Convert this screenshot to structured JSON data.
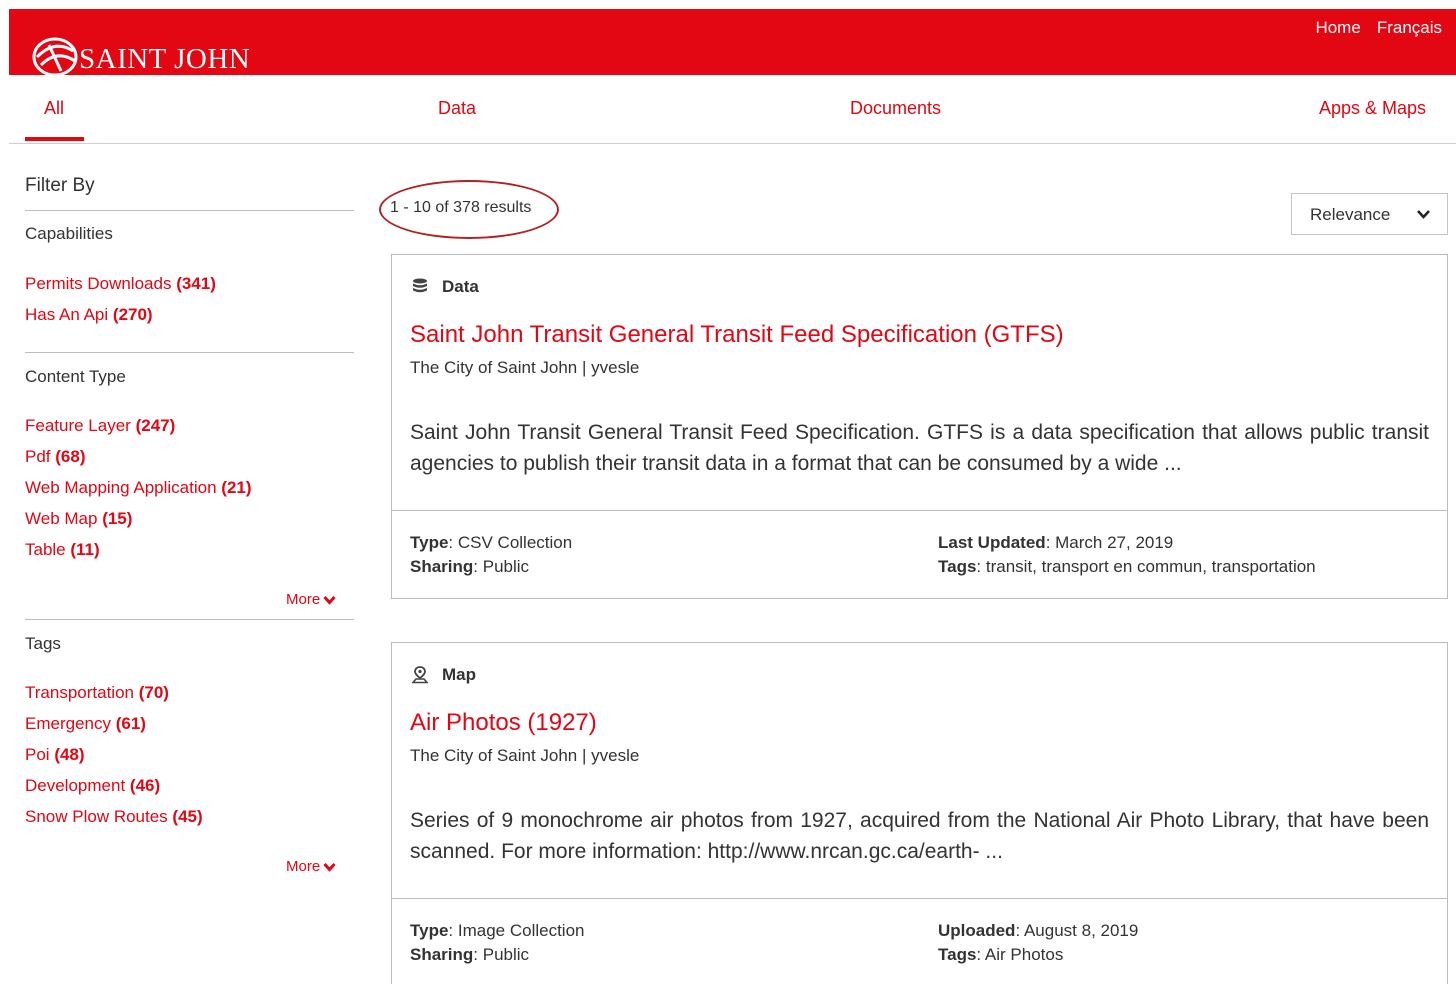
{
  "header": {
    "brand": "SAINT JOHN",
    "links": [
      "Home",
      "Français"
    ]
  },
  "tabs": [
    "All",
    "Data",
    "Documents",
    "Apps & Maps"
  ],
  "sidebar": {
    "title": "Filter By",
    "capabilities": {
      "title": "Capabilities",
      "items": [
        {
          "label": "Permits Downloads",
          "count": "(341)"
        },
        {
          "label": "Has An Api",
          "count": "(270)"
        }
      ]
    },
    "content_type": {
      "title": "Content Type",
      "items": [
        {
          "label": "Feature Layer",
          "count": "(247)"
        },
        {
          "label": "Pdf",
          "count": "(68)"
        },
        {
          "label": "Web Mapping Application",
          "count": "(21)"
        },
        {
          "label": "Web Map",
          "count": "(15)"
        },
        {
          "label": "Table",
          "count": "(11)"
        }
      ],
      "more": "More"
    },
    "tags": {
      "title": "Tags",
      "items": [
        {
          "label": "Transportation",
          "count": "(70)"
        },
        {
          "label": "Emergency",
          "count": "(61)"
        },
        {
          "label": "Poi",
          "count": "(48)"
        },
        {
          "label": "Development",
          "count": "(46)"
        },
        {
          "label": "Snow Plow Routes",
          "count": "(45)"
        }
      ],
      "more": "More"
    }
  },
  "results": {
    "count_text": "1 - 10 of 378 results",
    "sort": "Relevance",
    "items": [
      {
        "type": "Data",
        "icon": "database-icon",
        "title": "Saint John Transit General Transit Feed Specification (GTFS)",
        "owner": "The City of Saint John | yvesle",
        "desc": "Saint John Transit General Transit Feed Specification.  GTFS is a data specification that allows public transit agencies to publish their transit data in a format that can be consumed by a wide ...",
        "type_label": "Type",
        "type_value": ": CSV Collection",
        "sharing_label": "Sharing",
        "sharing_value": ": Public",
        "date_label": "Last Updated",
        "date_value": ": March 27, 2019",
        "tags_label": "Tags",
        "tags_value": ": transit, transport en commun, transportation"
      },
      {
        "type": "Map",
        "icon": "map-pin-icon",
        "title": "Air Photos (1927)",
        "owner": "The City of Saint John | yvesle",
        "desc": "Series of 9 monochrome air photos from 1927, acquired from the National Air Photo Library, that have been scanned. For more information: http://www.nrcan.gc.ca/earth- ...",
        "type_label": "Type",
        "type_value": ": Image Collection",
        "sharing_label": "Sharing",
        "sharing_value": ": Public",
        "date_label": "Uploaded",
        "date_value": ": August 8, 2019",
        "tags_label": "Tags",
        "tags_value": ": Air Photos"
      }
    ]
  },
  "colors": {
    "brand_red": "#e30613",
    "annotation_oval": "#b22222"
  }
}
